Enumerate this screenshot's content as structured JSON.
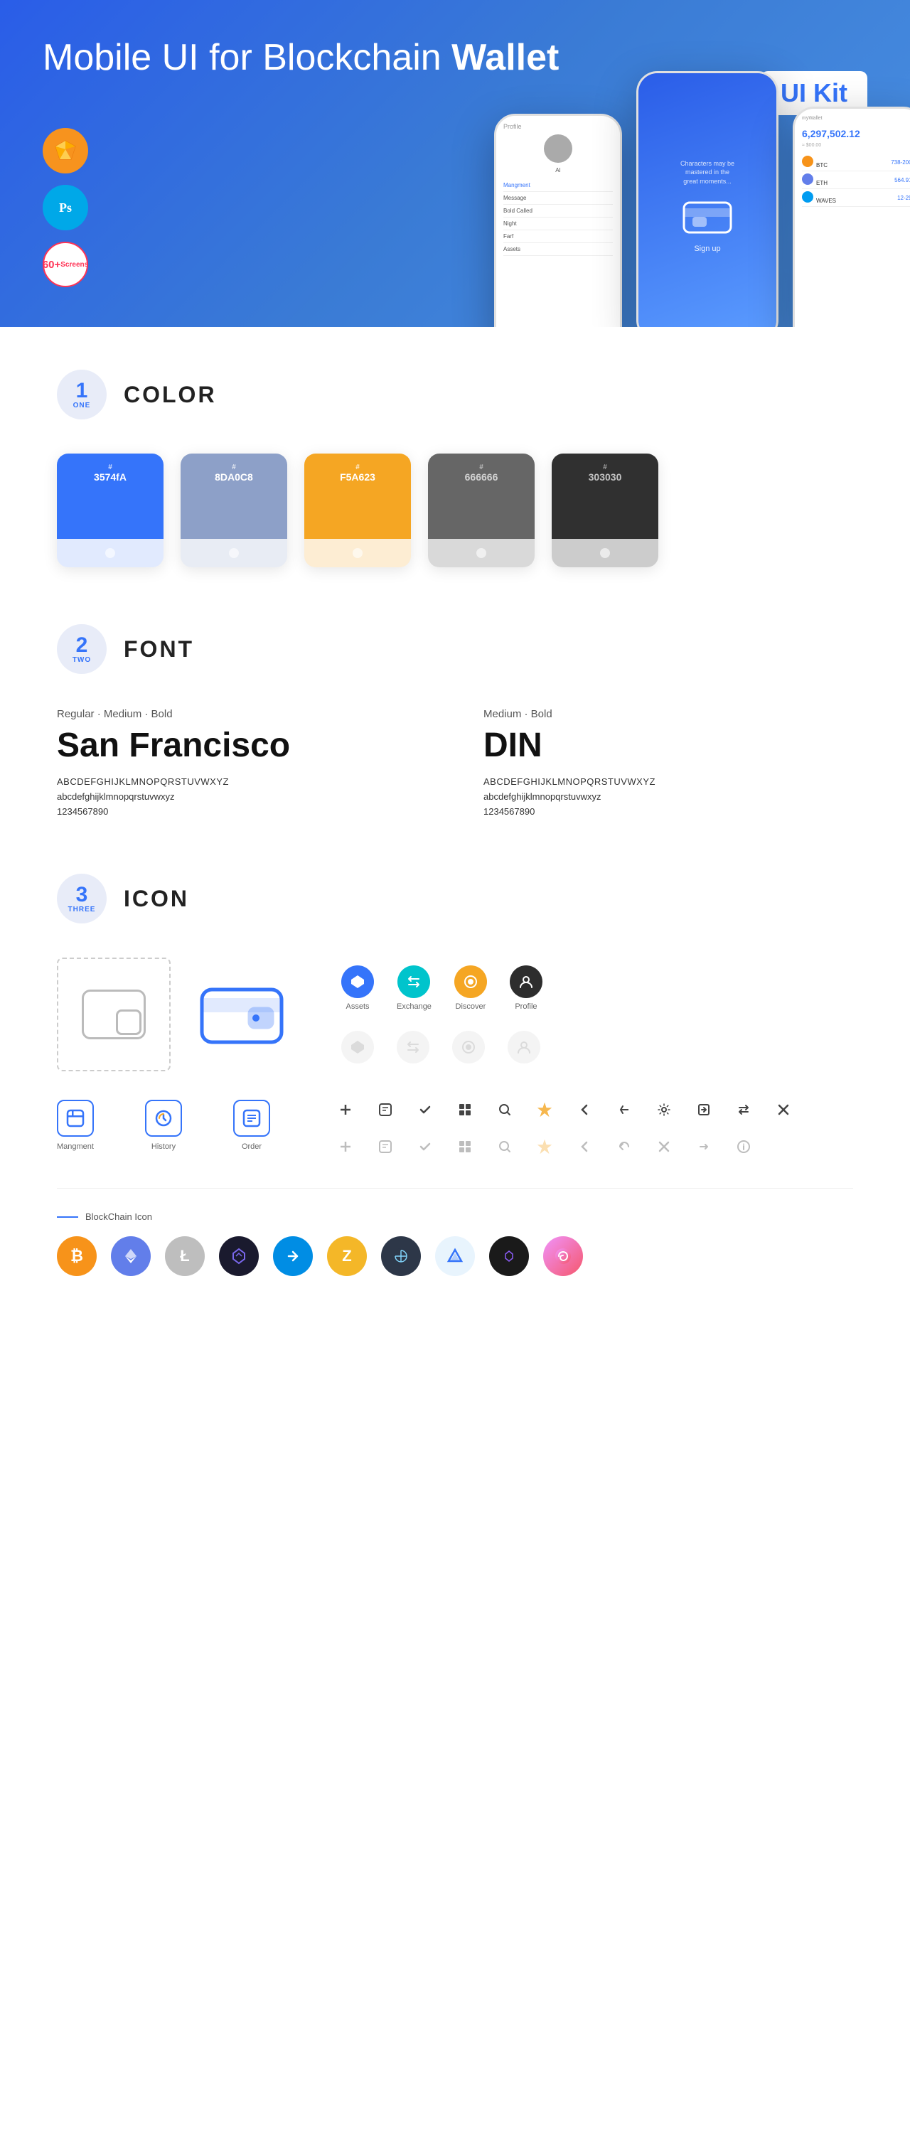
{
  "hero": {
    "title_regular": "Mobile UI for Blockchain ",
    "title_bold": "Wallet",
    "badge": "UI Kit",
    "sketch_label": "Sketch",
    "ps_label": "Ps",
    "screens_count": "60+",
    "screens_label": "Screens"
  },
  "sections": {
    "color": {
      "number": "1",
      "word": "ONE",
      "title": "COLOR",
      "swatches": [
        {
          "hex": "#3574FA",
          "label": "#",
          "value": "3574fA"
        },
        {
          "hex": "#8DA0C8",
          "label": "#",
          "value": "8DA0C8"
        },
        {
          "hex": "#F5A623",
          "label": "#",
          "value": "F5A623"
        },
        {
          "hex": "#666666",
          "label": "#",
          "value": "666666"
        },
        {
          "hex": "#303030",
          "label": "#",
          "value": "303030"
        }
      ]
    },
    "font": {
      "number": "2",
      "word": "TWO",
      "title": "FONT",
      "font1": {
        "style": "Regular · Medium · Bold",
        "name": "San Francisco",
        "uppercase": "ABCDEFGHIJKLMNOPQRSTUVWXYZ",
        "lowercase": "abcdefghijklmnopqrstuvwxyz",
        "numbers": "1234567890"
      },
      "font2": {
        "style": "Medium · Bold",
        "name": "DIN",
        "uppercase": "ABCDEFGHIJKLMNOPQRSTUVWXYZ",
        "lowercase": "abcdefghijklmnopqrstuvwxyz",
        "numbers": "1234567890"
      }
    },
    "icon": {
      "number": "3",
      "word": "THREE",
      "title": "ICON",
      "nav_icons": [
        {
          "label": "Assets",
          "symbol": "◆"
        },
        {
          "label": "Exchange",
          "symbol": "≋"
        },
        {
          "label": "Discover",
          "symbol": "◉"
        },
        {
          "label": "Profile",
          "symbol": "⌂"
        }
      ],
      "nav_icons_row2": [
        {
          "label": "",
          "symbol": "◆"
        },
        {
          "label": "",
          "symbol": "≋"
        },
        {
          "label": "",
          "symbol": "◉"
        },
        {
          "label": "",
          "symbol": "⌂"
        }
      ],
      "medium_icons": [
        {
          "label": "Mangment",
          "symbol": "▣"
        },
        {
          "label": "History",
          "symbol": "🕐"
        },
        {
          "label": "Order",
          "symbol": "📋"
        }
      ],
      "small_icons_row1": [
        "+",
        "⊞",
        "✓",
        "⊟",
        "🔍",
        "☆",
        "‹",
        "≺",
        "⚙",
        "⊡",
        "⇄",
        "✕"
      ],
      "small_icons_row2": [
        "+",
        "⊞",
        "✓",
        "⊟",
        "🔍",
        "☆",
        "‹",
        "≺",
        "⊡",
        "⊡",
        "⚙",
        "✕"
      ],
      "blockchain_label": "BlockChain Icon",
      "crypto": [
        {
          "symbol": "₿",
          "color_class": "ci-btc"
        },
        {
          "symbol": "Ξ",
          "color_class": "ci-eth"
        },
        {
          "symbol": "Ł",
          "color_class": "ci-ltc"
        },
        {
          "symbol": "◈",
          "color_class": "ci-black"
        },
        {
          "symbol": "D",
          "color_class": "ci-dash"
        },
        {
          "symbol": "Z",
          "color_class": "ci-zcash"
        },
        {
          "symbol": "⬡",
          "color_class": "ci-grid"
        },
        {
          "symbol": "▲",
          "color_class": "ci-safe"
        },
        {
          "symbol": "◈",
          "color_class": "ci-black2"
        },
        {
          "symbol": "∞",
          "color_class": "ci-pink"
        }
      ]
    }
  },
  "phone": {
    "amount": "6,297,502.12",
    "wallet_label": "myWallet",
    "btc_label": "BTC",
    "eth_label": "ETH",
    "waves_label": "WAVES"
  }
}
